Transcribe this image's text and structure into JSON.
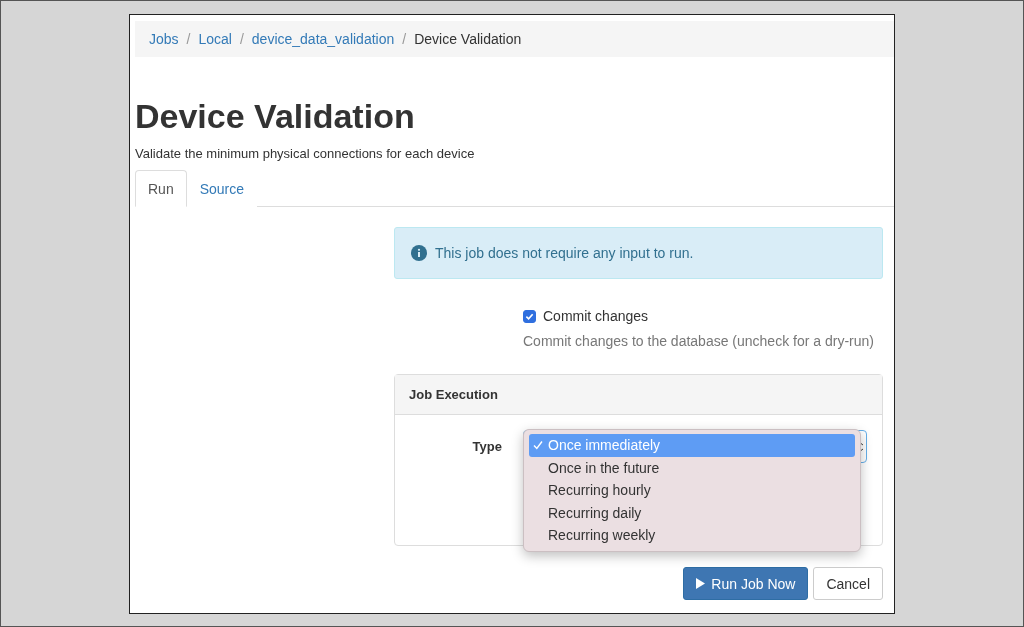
{
  "breadcrumb": [
    {
      "label": "Jobs",
      "kind": "link"
    },
    {
      "label": "/",
      "kind": "separator"
    },
    {
      "label": "Local",
      "kind": "link"
    },
    {
      "label": "/",
      "kind": "separator"
    },
    {
      "label": "device_data_validation",
      "kind": "link"
    },
    {
      "label": "/",
      "kind": "separator"
    },
    {
      "label": "Device Validation",
      "kind": "current"
    }
  ],
  "title": "Device Validation",
  "description": "Validate the minimum physical connections for each device",
  "tabs": [
    {
      "label": "Run",
      "selected": true
    },
    {
      "label": "Source",
      "selected": false
    }
  ],
  "alert": "This job does not require any input to run.",
  "commit": {
    "label": "Commit changes",
    "checked": true,
    "help": "Commit changes to the database (uncheck for a dry-run)"
  },
  "panel": {
    "title": "Job Execution",
    "field_label": "Type",
    "options": [
      {
        "label": "Once immediately",
        "selected": true
      },
      {
        "label": "Once in the future",
        "selected": false
      },
      {
        "label": "Recurring hourly",
        "selected": false
      },
      {
        "label": "Recurring daily",
        "selected": false
      },
      {
        "label": "Recurring weekly",
        "selected": false
      }
    ]
  },
  "buttons": [
    {
      "label": "Run Job Now",
      "kind": "primary"
    },
    {
      "label": "Cancel",
      "kind": "default"
    }
  ]
}
